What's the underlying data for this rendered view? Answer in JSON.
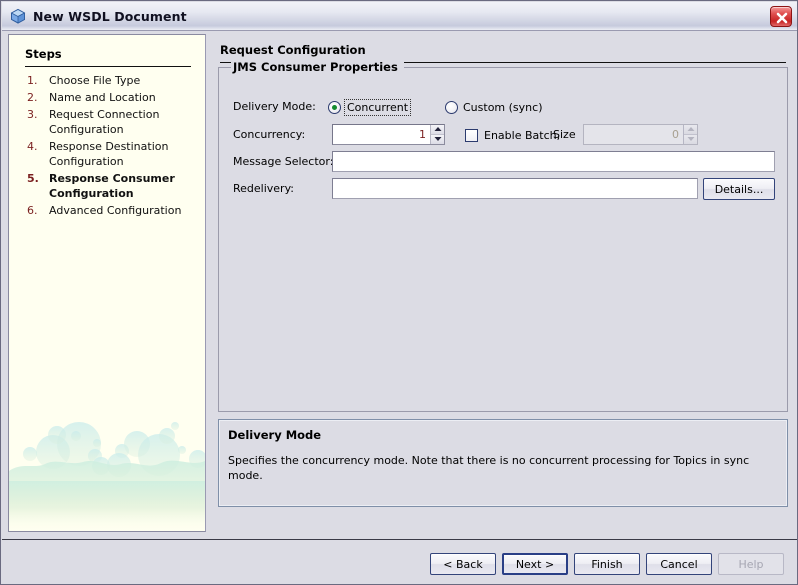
{
  "window": {
    "title": "New WSDL Document",
    "icon": "cube-icon",
    "close_label": "Close"
  },
  "sidebar": {
    "header": "Steps",
    "steps": [
      {
        "num": "1.",
        "label": "Choose File Type",
        "current": false
      },
      {
        "num": "2.",
        "label": "Name and Location",
        "current": false
      },
      {
        "num": "3.",
        "label": "Request Connection Configuration",
        "current": false
      },
      {
        "num": "4.",
        "label": "Response Destination Configuration",
        "current": false
      },
      {
        "num": "5.",
        "label": "Response Consumer Configuration",
        "current": true
      },
      {
        "num": "6.",
        "label": "Advanced Configuration",
        "current": false
      }
    ]
  },
  "main": {
    "page_title": "Request Configuration",
    "group_title": "JMS Consumer Properties",
    "delivery_mode": {
      "label": "Delivery Mode:",
      "options": [
        {
          "label": "Concurrent",
          "checked": true,
          "focused": true
        },
        {
          "label": "Custom (sync)",
          "checked": false,
          "focused": false
        }
      ]
    },
    "concurrency": {
      "label": "Concurrency:",
      "value": "1",
      "enabled": true
    },
    "enable_batch": {
      "label": "Enable Batch,",
      "checked": false,
      "size_label": "Size",
      "size_value": "0",
      "size_enabled": false
    },
    "message_selector": {
      "label": "Message Selector:",
      "value": ""
    },
    "redelivery": {
      "label": "Redelivery:",
      "value": "",
      "details_label": "Details..."
    }
  },
  "description": {
    "title": "Delivery Mode",
    "text": "Specifies the concurrency mode. Note that there is no concurrent processing for Topics in sync mode."
  },
  "buttons": {
    "back": "< Back",
    "next": "Next >",
    "finish": "Finish",
    "cancel": "Cancel",
    "help": "Help"
  },
  "colors": {
    "accent_blue": "#2a3f86",
    "radio_dot_green": "#138b2e",
    "step_number": "#7a1f1f",
    "close_red": "#c72424",
    "panel_bg": "#dcdce4",
    "sidebar_bg": "#fffff0"
  }
}
